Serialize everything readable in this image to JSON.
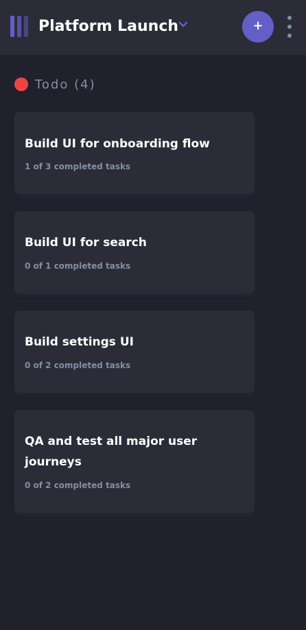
{
  "header": {
    "board_title": "Platform Launch",
    "add_task_label": "+",
    "logo_icon": "kanban-logo-icon",
    "chevron_icon": "chevron-down-icon",
    "menu_icon": "vertical-ellipsis-icon"
  },
  "colors": {
    "accent": "#635fc7",
    "todo_status": "#ef4444",
    "background": "#20212c",
    "surface": "#2b2c37",
    "muted_text": "#828fa3"
  },
  "columns": [
    {
      "title": "Todo (4)",
      "tasks": [
        {
          "title": "Build UI for onboarding flow",
          "subtasks": "1 of 3 completed tasks"
        },
        {
          "title": "Build UI for search",
          "subtasks": "0 of 1 completed tasks"
        },
        {
          "title": "Build settings UI",
          "subtasks": "0 of 2 completed tasks"
        },
        {
          "title": "QA and test all major user journeys",
          "subtasks": "0 of 2 completed tasks"
        }
      ]
    }
  ]
}
